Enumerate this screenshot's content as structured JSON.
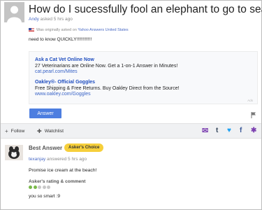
{
  "question": {
    "title": "How do I sucessfully fool an elephant to go to sea?",
    "author": "Andy",
    "asked": "asked 5 hrs ago",
    "origin_prefix": "Was originally asked on",
    "origin_site": "Yahoo Answers United States",
    "body": "need to know QUICKLY!!!!!!!!!!!!"
  },
  "ads": {
    "items": [
      {
        "title": "Ask a Cat Vet Online Now",
        "desc": "27 Veterinarians are Online Now. Get a 1-on-1 Answer in Minutes!",
        "url": "cat.pearl.com/Mites"
      },
      {
        "title": "Oakley®- Official Goggles",
        "desc": "Free Shipping & Free Returns. Buy Oakley Direct from the Source!",
        "url": "www.oakley.com/Goggles"
      }
    ],
    "label": "Ads"
  },
  "answer_button": "Answer",
  "action_bar": {
    "follow": "Follow",
    "watchlist": "Watchlist"
  },
  "best_answer": {
    "heading": "Best Answer",
    "badge": "Asker's Choice",
    "author": "texanjay",
    "answered": "answered 5 hrs ago",
    "body": "Promise ice cream at the beach!",
    "rating_heading": "Asker's rating & comment",
    "rating": 2,
    "rating_max": 5,
    "comment": "you so smart :9"
  },
  "colors": {
    "accent": "#4d7ee0",
    "badge": "#f6cf3b",
    "rating_on": "#79b84a"
  }
}
